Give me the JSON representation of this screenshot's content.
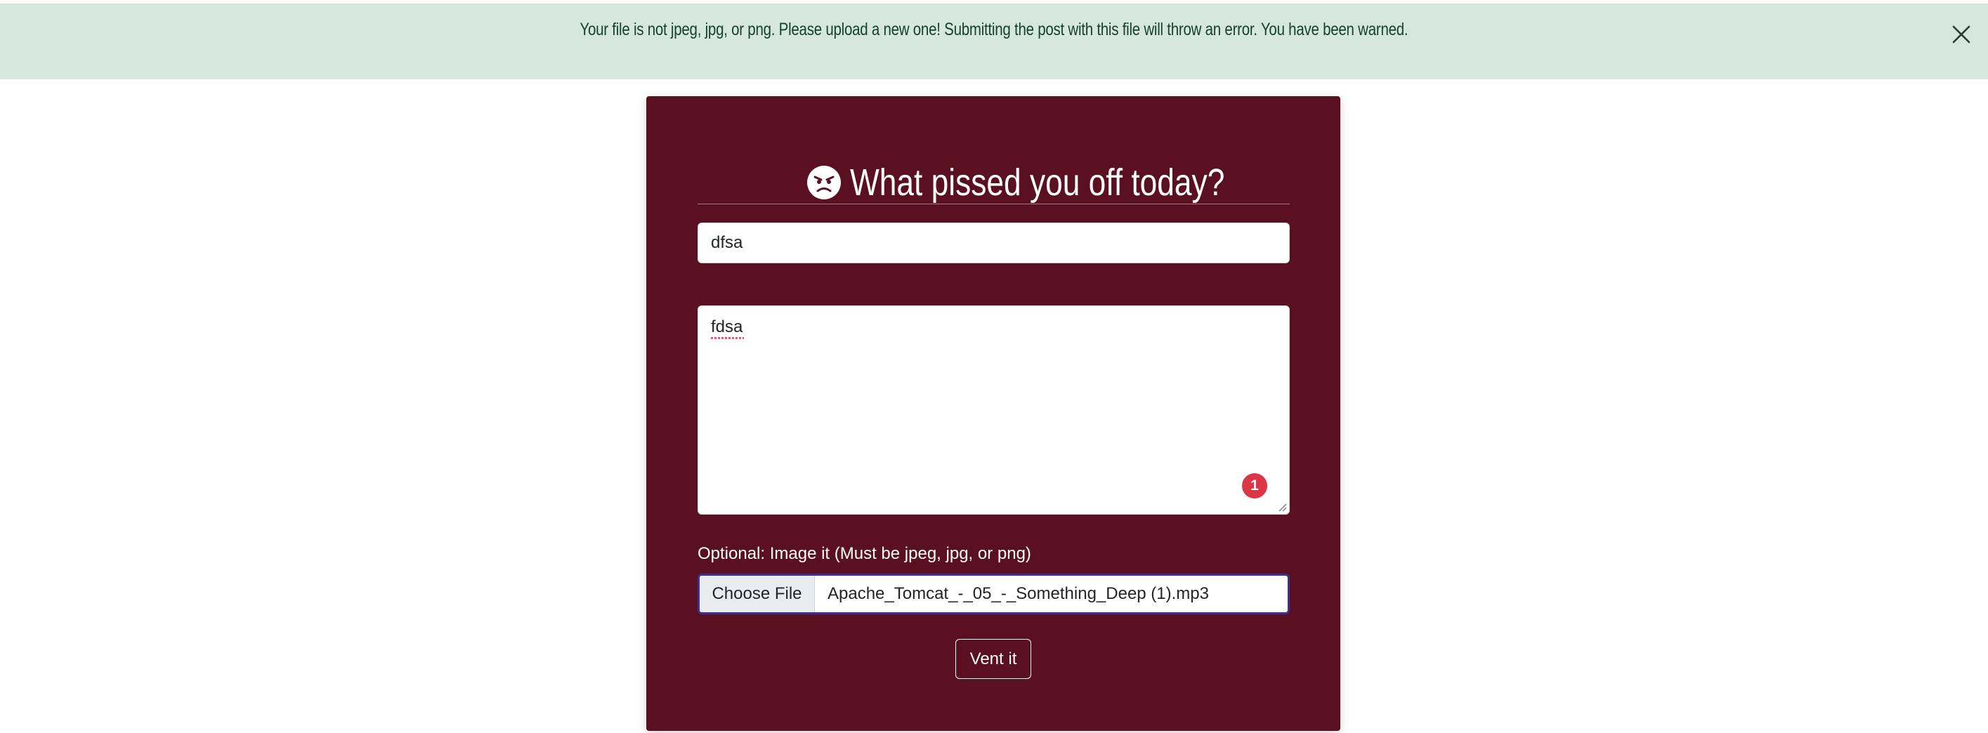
{
  "alert": {
    "message": "Your file is not jpeg, jpg, or png. Please upload a new one! Submitting the post with this file will throw an error. You have been warned.",
    "close_icon": "close-icon",
    "background_color": "#d5e7df"
  },
  "form": {
    "title_icon": "angry-face-icon",
    "title": "What pissed you off today?",
    "background_color": "#5a1020",
    "title_field": {
      "value": "dfsa"
    },
    "body_field": {
      "value": "fdsa",
      "error_count": "1"
    },
    "file_field": {
      "label": "Optional: Image it (Must be jpeg, jpg, or png)",
      "button_label": "Choose File",
      "file_name": "Apache_Tomcat_-_05_-_Something_Deep (1).mp3"
    },
    "submit_label": "Vent it"
  }
}
